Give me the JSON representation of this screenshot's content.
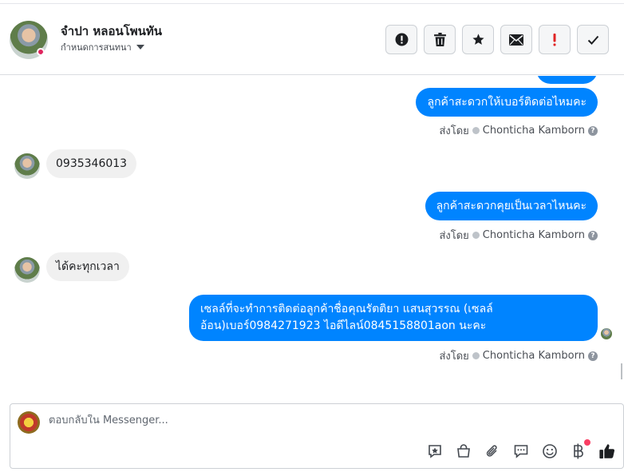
{
  "header": {
    "contact_name": "จำปา หลอนโพนทัน",
    "assign_label": "กำหนดการสนทนา",
    "toolbar": [
      {
        "name": "spam-button",
        "icon": "alert-circle-icon"
      },
      {
        "name": "delete-button",
        "icon": "trash-icon"
      },
      {
        "name": "star-button",
        "icon": "star-icon"
      },
      {
        "name": "mark-unread-button",
        "icon": "envelope-icon"
      },
      {
        "name": "follow-up-button",
        "icon": "exclamation-icon"
      },
      {
        "name": "mark-done-button",
        "icon": "checkmark-icon"
      }
    ]
  },
  "messages": [
    {
      "dir": "out",
      "text": "ลูกค้าสะดวกให้เบอร์ติดต่อไหมคะ"
    },
    {
      "dir": "meta",
      "prefix": "ส่งโดย",
      "agent": "Chonticha Kamborn"
    },
    {
      "dir": "in",
      "text": "0935346013"
    },
    {
      "dir": "out",
      "text": "ลูกค้าสะดวกคุยเป็นเวลาไหนคะ"
    },
    {
      "dir": "meta",
      "prefix": "ส่งโดย",
      "agent": "Chonticha Kamborn"
    },
    {
      "dir": "in",
      "text": "ได้คะทุกเวลา"
    },
    {
      "dir": "out",
      "line1": "เซลล์ที่จะทำการติดต่อลูกค้าชื่อคุณรัตติยา แสนสุวรรณ (เซลล์",
      "line2": "อ้อน)เบอร์0984271923 ไอดีไลน์0845158801aon นะคะ"
    },
    {
      "dir": "meta",
      "prefix": "ส่งโดย",
      "agent": "Chonticha Kamborn"
    }
  ],
  "composer": {
    "placeholder": "ตอบกลับใน Messenger...",
    "icons": [
      "saved-reply-icon",
      "shop-bag-icon",
      "attachment-icon",
      "chat-bubble-icon",
      "emoji-icon",
      "baht-icon",
      "thumbs-up-icon"
    ],
    "accent": "#0084ff"
  },
  "colors": {
    "outgoing_bubble": "#0084ff",
    "incoming_bubble": "#f0f0f0",
    "notification_dot": "#fa3e63"
  }
}
